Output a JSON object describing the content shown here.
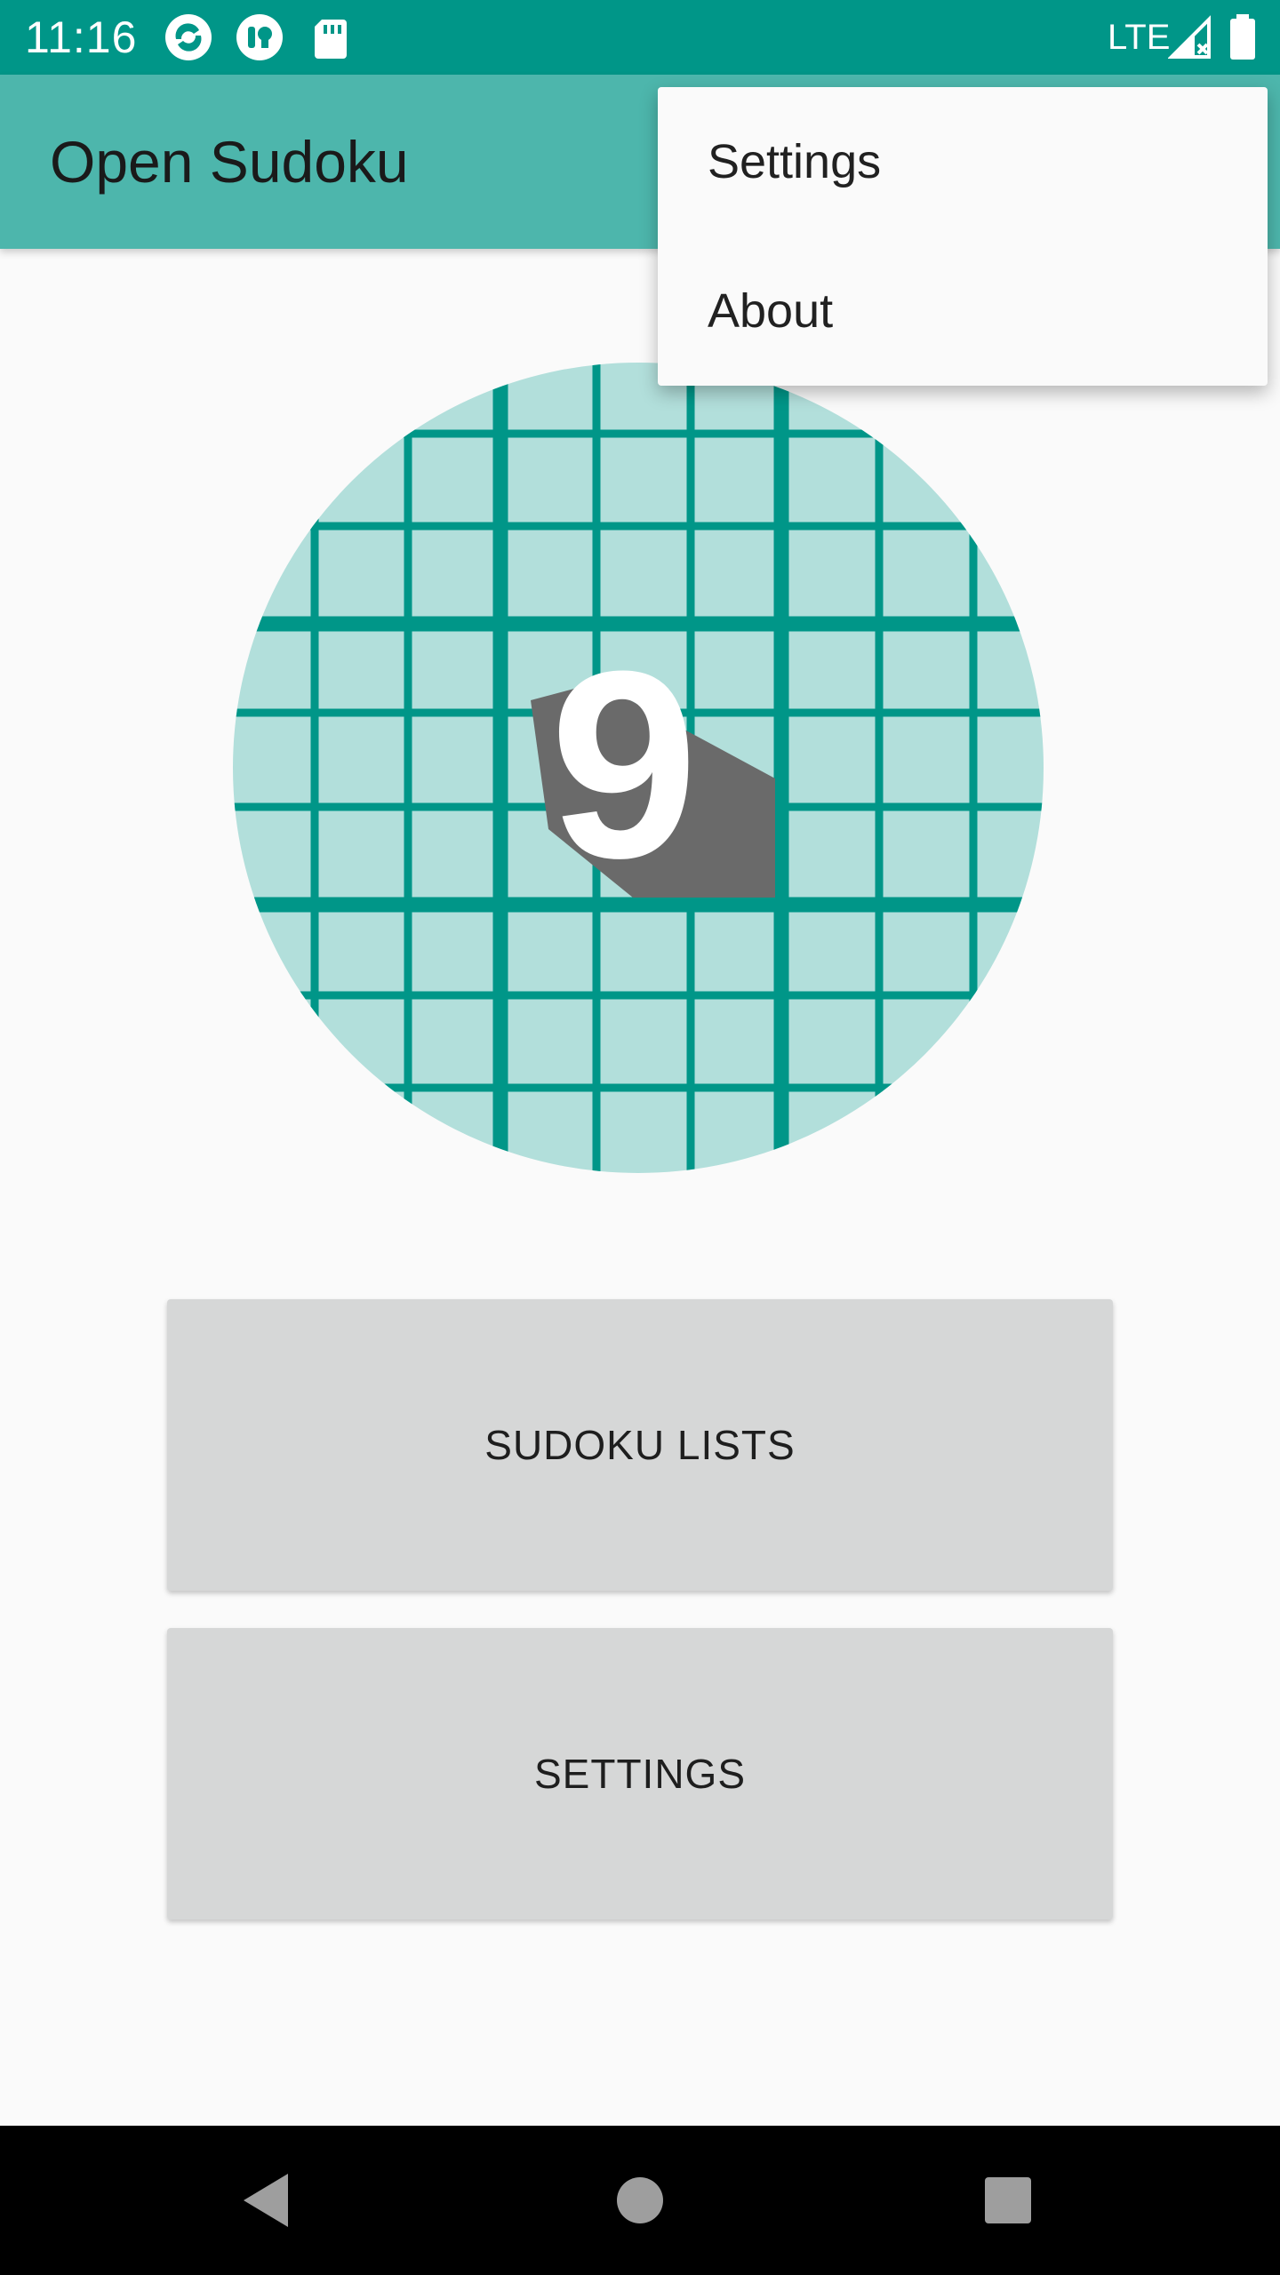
{
  "status_bar": {
    "time": "11:16",
    "network": "LTE",
    "icons": [
      "app-notification-icon",
      "app-notification-icon-2",
      "sd-card-icon",
      "signal-icon",
      "battery-icon"
    ],
    "background_color": "#009688"
  },
  "app_bar": {
    "title": "Open Sudoku",
    "background_color": "#4db6ac"
  },
  "logo": {
    "digit": "9",
    "grid_color": "#009688",
    "fill_color": "#b2dfdb",
    "shadow_color": "#6a6a6a"
  },
  "buttons": {
    "sudoku_lists": "SUDOKU LISTS",
    "settings": "SETTINGS"
  },
  "overflow_menu": {
    "items": [
      {
        "label": "Settings"
      },
      {
        "label": "About"
      }
    ]
  },
  "navigation": {
    "icons": [
      "back-icon",
      "home-icon",
      "recents-icon"
    ]
  }
}
